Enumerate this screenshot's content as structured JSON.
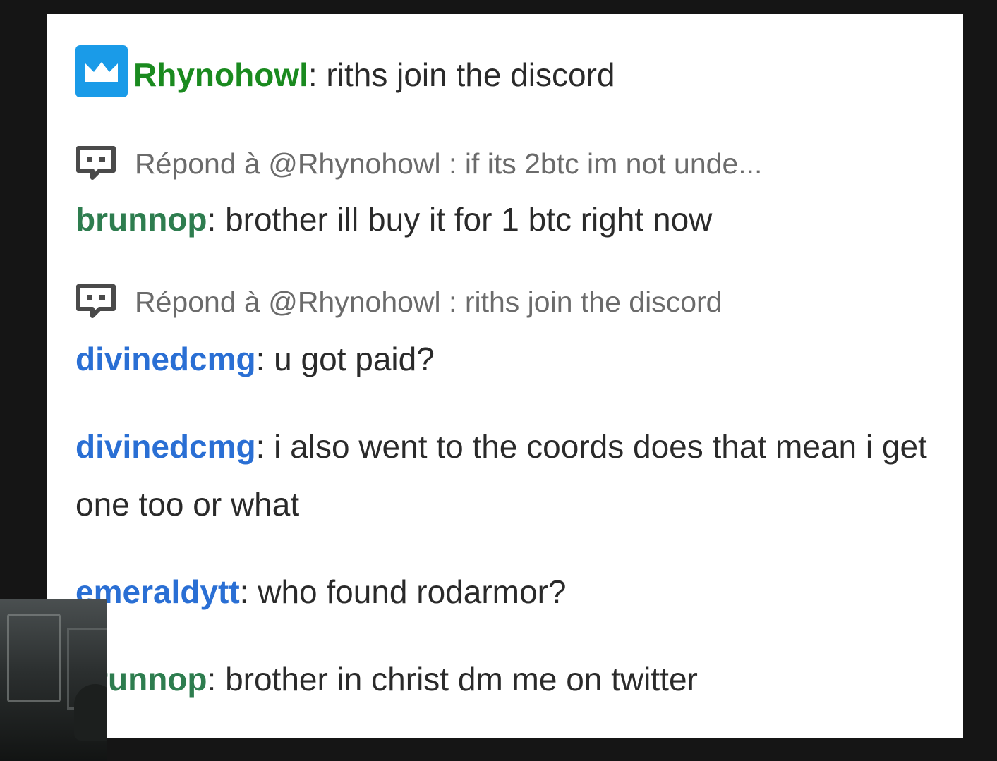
{
  "colors": {
    "rhynohowl": "#1a8a1f",
    "brunnop": "#2e7d4f",
    "divinedcmg": "#2a6fd4",
    "emeraldytt": "#2a6fd4",
    "badge": "#1a9be8",
    "reply_text": "#6b6b6b"
  },
  "icons": {
    "badge": "crown-badge-icon",
    "reply": "reply-speech-bubble-icon"
  },
  "messages": [
    {
      "user": "Rhynohowl",
      "sep": ": ",
      "text": "riths join the discord"
    },
    {
      "reply": "Répond à @Rhynohowl : if its 2btc im not unde...",
      "user": "brunnop",
      "sep": ": ",
      "text": "brother ill buy it for 1 btc right now"
    },
    {
      "reply": "Répond à @Rhynohowl : riths join the discord",
      "user": "divinedcmg",
      "sep": ": ",
      "text": "u got paid?"
    },
    {
      "user": "divinedcmg",
      "sep": ": ",
      "text": "i also went to the coords does that mean i get one too or what"
    },
    {
      "user": "emeraldytt",
      "sep": ": ",
      "text": "who found rodarmor?"
    },
    {
      "user": "brunnop",
      "sep": ": ",
      "text": "brother in christ dm me on twitter"
    }
  ]
}
